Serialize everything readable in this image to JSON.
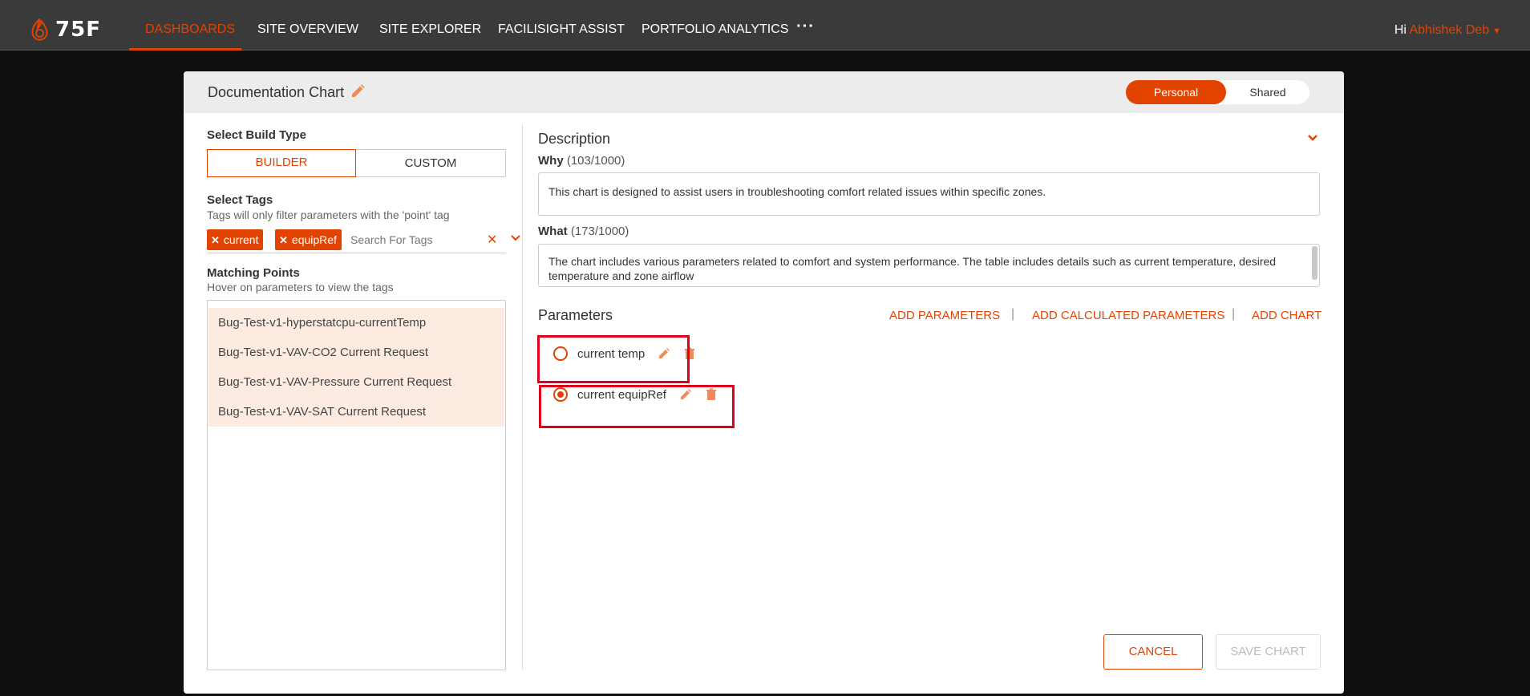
{
  "app": {
    "logo_text": "75F",
    "nav": {
      "items": [
        "DASHBOARDS",
        "SITE OVERVIEW",
        "SITE EXPLORER",
        "FACILISIGHT ASSIST",
        "PORTFOLIO ANALYTICS"
      ],
      "more_label": "···"
    },
    "greeting": {
      "prefix": "Hi",
      "user": "Abhishek Deb"
    },
    "colors": {
      "accent": "#e24301",
      "topbar": "#3a3a3a",
      "highlight": "#e0001b"
    }
  },
  "modal": {
    "title": "Documentation Chart",
    "visibility": {
      "personal": "Personal",
      "shared": "Shared",
      "selected": "Personal"
    },
    "build_type": {
      "label": "Select Build Type",
      "options": [
        "BUILDER",
        "CUSTOM"
      ],
      "selected": "BUILDER"
    },
    "tags": {
      "label": "Select Tags",
      "hint": "Tags will only filter parameters with the 'point' tag",
      "selected": [
        "current",
        "equipRef"
      ],
      "search_placeholder": "Search For Tags"
    },
    "matching_points": {
      "label": "Matching Points",
      "hint": "Hover on parameters to view the tags",
      "items": [
        "Bug-Test-v1-hyperstatcpu-currentTemp",
        "Bug-Test-v1-VAV-CO2 Current Request",
        "Bug-Test-v1-VAV-Pressure Current Request",
        "Bug-Test-v1-VAV-SAT Current Request"
      ]
    },
    "description": {
      "title": "Description",
      "why": {
        "label": "Why",
        "count": "(103/1000)",
        "value": "This chart is designed to assist users in troubleshooting comfort related issues within specific zones."
      },
      "what": {
        "label": "What",
        "count": "(173/1000)",
        "value": "The chart includes various parameters related to comfort and system performance. The table includes details such as current temperature, desired temperature and zone airflow"
      }
    },
    "parameters": {
      "title": "Parameters",
      "actions": [
        "ADD PARAMETERS",
        "ADD CALCULATED PARAMETERS",
        "ADD CHART"
      ],
      "separator": "|",
      "items": [
        {
          "label": "current temp",
          "selected": false
        },
        {
          "label": "current equipRef",
          "selected": true
        }
      ]
    },
    "footer": {
      "cancel": "CANCEL",
      "save": "SAVE CHART"
    }
  }
}
